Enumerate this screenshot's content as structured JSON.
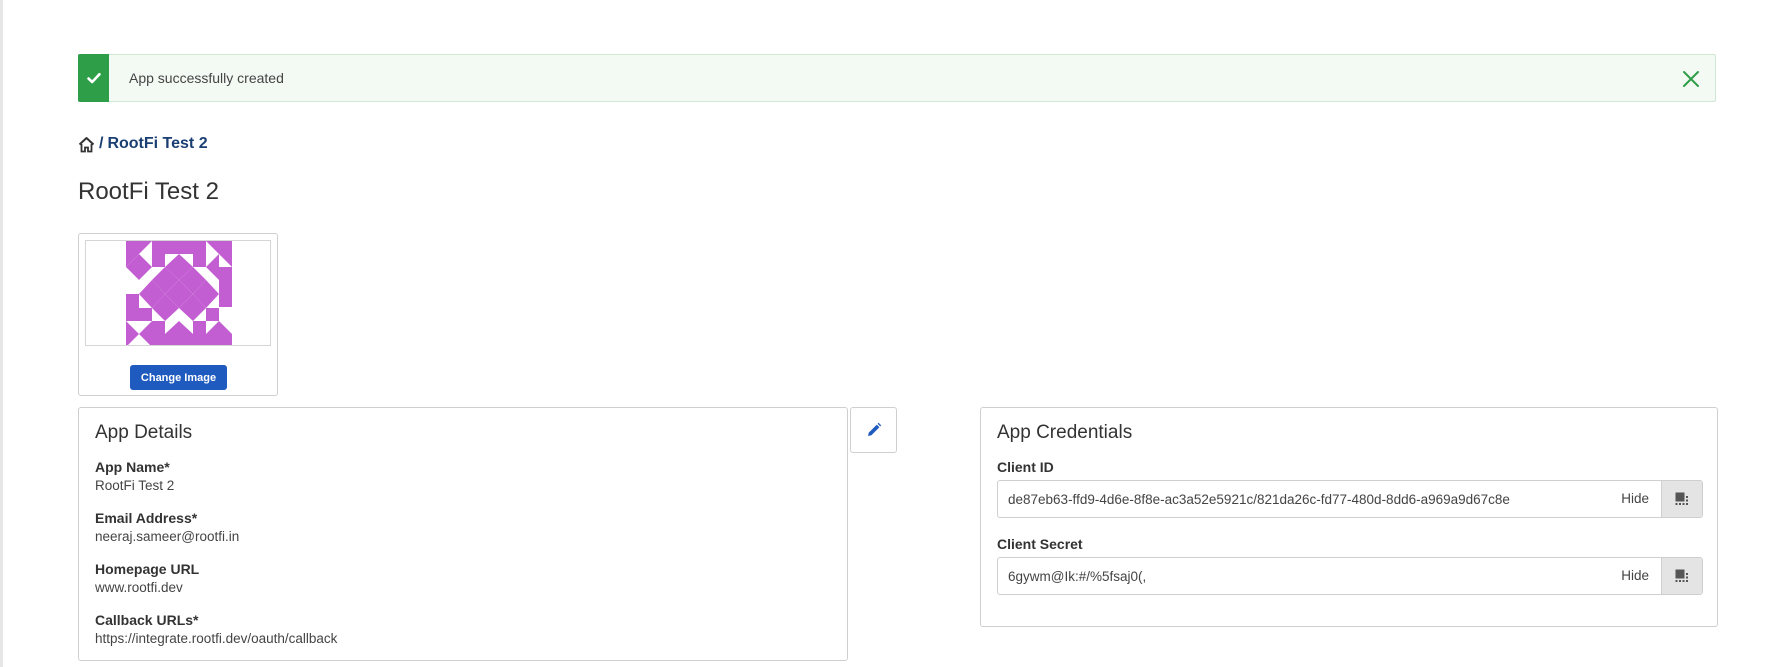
{
  "alert": {
    "message": "App successfully created",
    "icon": "check-icon",
    "color": "#2e9e48"
  },
  "breadcrumb": {
    "home_icon": "home-icon",
    "separator": "/",
    "current": "RootFi Test 2"
  },
  "page": {
    "title": "RootFi Test 2"
  },
  "image_card": {
    "button_label": "Change Image",
    "image_color": "#c35ed2"
  },
  "details": {
    "title": "App Details",
    "fields": [
      {
        "label": "App Name*",
        "value": "RootFi Test 2"
      },
      {
        "label": "Email Address*",
        "value": "neeraj.sameer@rootfi.in"
      },
      {
        "label": "Homepage URL",
        "value": "www.rootfi.dev"
      },
      {
        "label": "Callback URLs*",
        "value": "https://integrate.rootfi.dev/oauth/callback"
      }
    ],
    "edit_icon": "pencil-icon"
  },
  "credentials": {
    "title": "App Credentials",
    "client_id": {
      "label": "Client ID",
      "value": "de87eb63-ffd9-4d6e-8f8e-ac3a52e5921c/821da26c-fd77-480d-8dd6-a969a9d67c8e",
      "toggle_label": "Hide",
      "copy_icon": "copy-icon"
    },
    "client_secret": {
      "label": "Client Secret",
      "value": "6gywm@Ik:#/%5fsaj0(,",
      "toggle_label": "Hide",
      "copy_icon": "copy-icon"
    }
  },
  "colors": {
    "primary": "#1f5abf",
    "link": "#1a3f73",
    "success": "#2e9e48"
  }
}
